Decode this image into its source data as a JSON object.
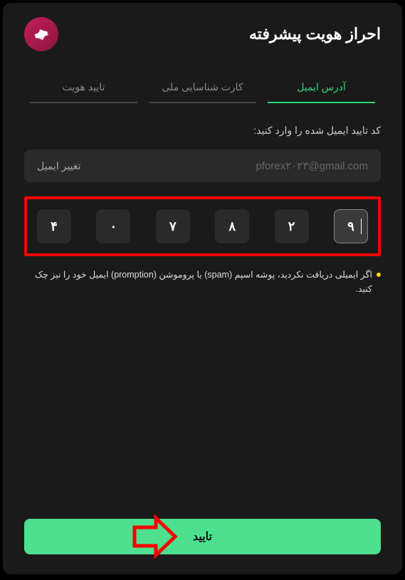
{
  "header": {
    "title": "احراز هویت پیشرفته"
  },
  "tabs": {
    "email": "آدرس ایمیل",
    "national_id": "کارت شناسایی ملی",
    "identity": "تایید هویت"
  },
  "instruction": "کد تایید ایمیل شده را وارد کنید:",
  "email": {
    "value": "pforex۲۰۲۳@gmail.com",
    "change_label": "تغییر ایمیل"
  },
  "otp": [
    "۴",
    "۰",
    "۷",
    "۸",
    "۲",
    "۹"
  ],
  "hint": "اگر ایمیلی دریافت نکردید، پوشه اسپم (spam) یا پروموشن (promption) ایمیل خود را نیز چک کنید.",
  "submit": "تایید"
}
